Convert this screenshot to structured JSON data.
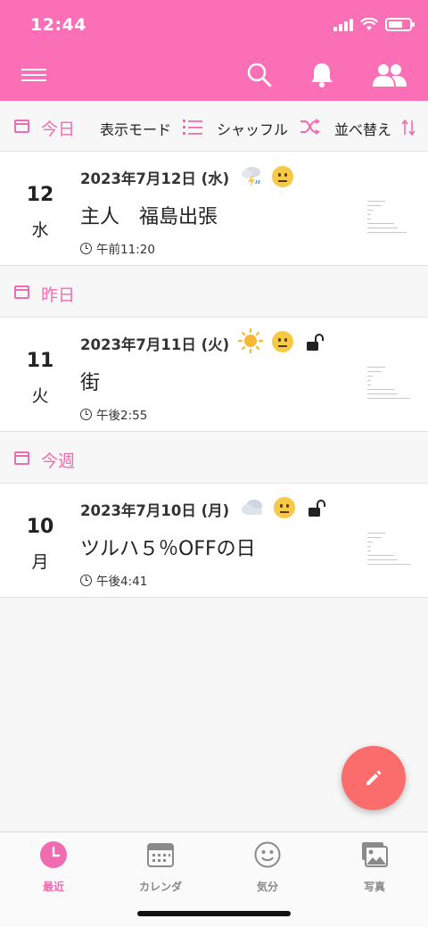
{
  "status_bar": {
    "time": "12:44"
  },
  "toolbar": {
    "today_label": "今日",
    "display_mode_label": "表示モード",
    "shuffle_label": "シャッフル",
    "sort_label": "並べ替え"
  },
  "sections": [
    {
      "title": "昨日"
    },
    {
      "title": "今週"
    }
  ],
  "entries": [
    {
      "day": "12",
      "weekday": "水",
      "date": "2023年7月12日 (水)",
      "title": "主人　福島出張",
      "time": "午前11:20",
      "weather": "thunder-rain-icon",
      "mood": "neutral-face-icon",
      "locked": false
    },
    {
      "day": "11",
      "weekday": "火",
      "date": "2023年7月11日 (火)",
      "title": "街",
      "time": "午後2:55",
      "weather": "sun-icon",
      "mood": "neutral-face-icon",
      "locked": true
    },
    {
      "day": "10",
      "weekday": "月",
      "date": "2023年7月10日 (月)",
      "title": "ツルハ５％OFFの日",
      "time": "午後4:41",
      "weather": "cloud-icon",
      "mood": "neutral-face-icon",
      "locked": true
    }
  ],
  "bottom_nav": [
    {
      "label": "最近",
      "icon": "clock-icon",
      "active": true
    },
    {
      "label": "カレンダ",
      "icon": "calendar-icon",
      "active": false
    },
    {
      "label": "気分",
      "icon": "smiley-icon",
      "active": false
    },
    {
      "label": "写真",
      "icon": "photos-icon",
      "active": false
    }
  ],
  "colors": {
    "primary": "#fb6fb6",
    "accent_text": "#f06cb0",
    "fab": "#fb6c6c"
  }
}
